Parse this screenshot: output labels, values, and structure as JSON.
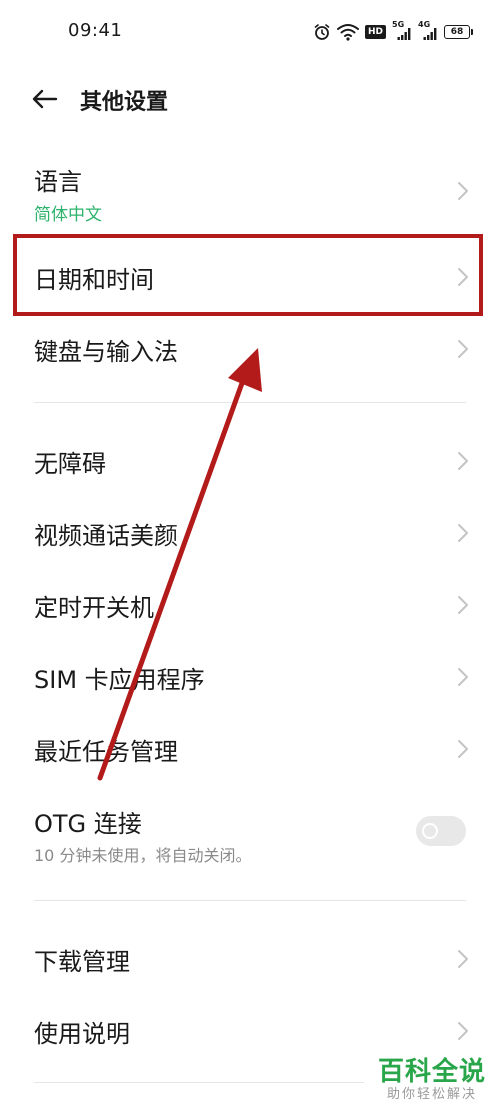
{
  "status_bar": {
    "time": "09:41",
    "network_1": "5G",
    "network_2": "4G",
    "hd_label": "HD",
    "battery": "68"
  },
  "header": {
    "title": "其他设置"
  },
  "items": {
    "language": {
      "title": "语言",
      "value": "简体中文"
    },
    "date_time": {
      "title": "日期和时间"
    },
    "keyboard": {
      "title": "键盘与输入法"
    },
    "accessibility": {
      "title": "无障碍"
    },
    "video_beauty": {
      "title": "视频通话美颜"
    },
    "scheduled_power": {
      "title": "定时开关机"
    },
    "sim_toolkit": {
      "title": "SIM 卡应用程序"
    },
    "recent_tasks": {
      "title": "最近任务管理"
    },
    "otg": {
      "title": "OTG 连接",
      "description": "10 分钟未使用，将自动关闭。",
      "enabled": false
    },
    "downloads": {
      "title": "下载管理"
    },
    "manual": {
      "title": "使用说明"
    }
  },
  "watermark": {
    "main": "百科全说",
    "sub": "助你轻松解决"
  },
  "colors": {
    "accent_green": "#2db36b",
    "annotation_red": "#b31b1b",
    "watermark_green": "#2aa64a"
  }
}
